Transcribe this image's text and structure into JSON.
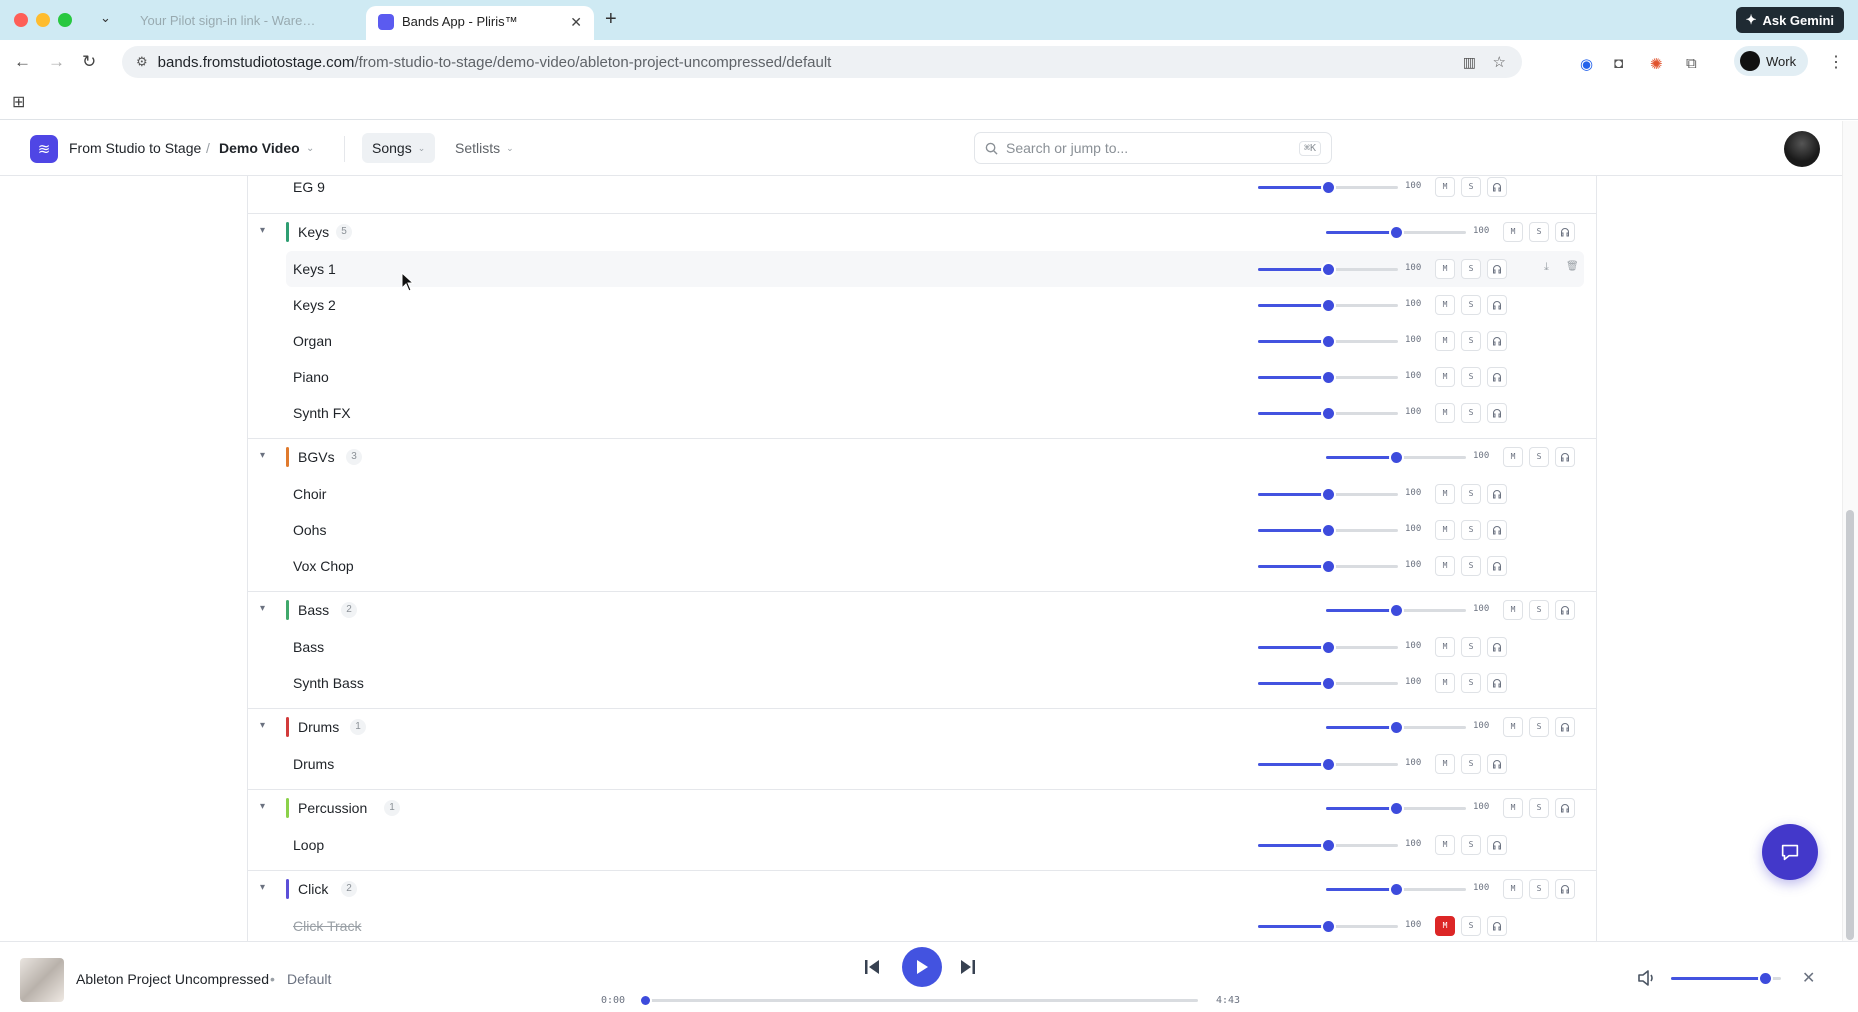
{
  "browser": {
    "inactive_tab_title": "Your Pilot sign-in link - Ware…",
    "active_tab_title": "Bands App - Pliris™",
    "ask_gemini": "Ask Gemini",
    "url_host": "bands.fromstudiotostage.com",
    "url_path": "/from-studio-to-stage/demo-video/ableton-project-uncompressed/default",
    "profile": "Work"
  },
  "header": {
    "org": "From Studio to Stage",
    "separator": "/",
    "project": "Demo Video",
    "songs_label": "Songs",
    "setlists_label": "Setlists",
    "search_placeholder": "Search or jump to...",
    "search_shortcut": "⌘K"
  },
  "tracks": {
    "eg9": {
      "name": "EG 9",
      "volume": "100"
    },
    "keys": {
      "name": "Keys",
      "count": "5",
      "volume": "100",
      "color": "#2f9e72",
      "items": [
        {
          "name": "Keys 1",
          "volume": "100"
        },
        {
          "name": "Keys 2",
          "volume": "100"
        },
        {
          "name": "Organ",
          "volume": "100"
        },
        {
          "name": "Piano",
          "volume": "100"
        },
        {
          "name": "Synth FX",
          "volume": "100"
        }
      ]
    },
    "bgvs": {
      "name": "BGVs",
      "count": "3",
      "volume": "100",
      "color": "#e07a2d",
      "items": [
        {
          "name": "Choir",
          "volume": "100"
        },
        {
          "name": "Oohs",
          "volume": "100"
        },
        {
          "name": "Vox Chop",
          "volume": "100"
        }
      ]
    },
    "bass": {
      "name": "Bass",
      "count": "2",
      "volume": "100",
      "color": "#3fa86b",
      "items": [
        {
          "name": "Bass",
          "volume": "100"
        },
        {
          "name": "Synth Bass",
          "volume": "100"
        }
      ]
    },
    "drums": {
      "name": "Drums",
      "count": "1",
      "volume": "100",
      "color": "#d23b3b",
      "items": [
        {
          "name": "Drums",
          "volume": "100"
        }
      ]
    },
    "percussion": {
      "name": "Percussion",
      "count": "1",
      "volume": "100",
      "color": "#8bd14a",
      "items": [
        {
          "name": "Loop",
          "volume": "100"
        }
      ]
    },
    "click": {
      "name": "Click",
      "count": "2",
      "volume": "100",
      "color": "#5b4fd8",
      "items": [
        {
          "name": "Click Track",
          "volume": "100",
          "muted": true
        }
      ]
    },
    "button_labels": {
      "mute": "M",
      "solo": "S"
    },
    "slider_level": 0.5
  },
  "player": {
    "title": "Ableton Project Uncompressed",
    "dot": "•",
    "arrangement": "Default",
    "time_current": "0:00",
    "time_total": "4:43",
    "progress": 0.0,
    "master_volume": 0.85
  },
  "colors": {
    "accent": "#4353e0",
    "mute_active": "#dc2626"
  }
}
